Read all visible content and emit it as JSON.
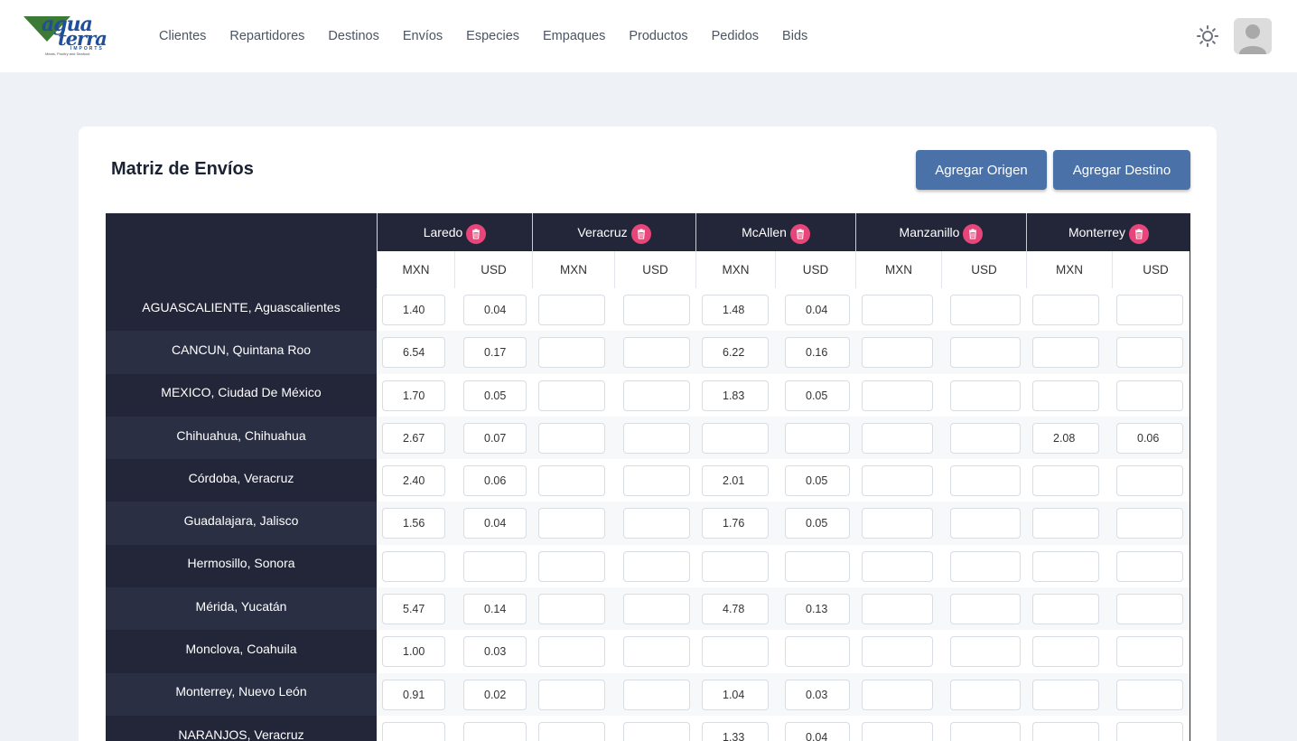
{
  "header": {
    "logo": {
      "line1": "agua",
      "line2": "terra",
      "line3": "IMPORTS",
      "tagline": "Meats, Poultry and Seafood"
    },
    "nav": [
      "Clientes",
      "Repartidores",
      "Destinos",
      "Envíos",
      "Especies",
      "Empaques",
      "Productos",
      "Pedidos",
      "Bids"
    ],
    "icons": {
      "theme": "sun-icon",
      "avatar": "user-avatar-icon"
    }
  },
  "page": {
    "title": "Matriz de Envíos",
    "buttons": {
      "agregar_origen": "Agregar Origen",
      "agregar_destino": "Agregar Destino"
    }
  },
  "matrix": {
    "colors": {
      "header_bg": "#222638",
      "trash": "#e8467a",
      "button": "#4a72a8"
    },
    "destinations": [
      "Laredo",
      "Veracruz",
      "McAllen",
      "Manzanillo",
      "Monterrey"
    ],
    "subheaders": [
      "MXN",
      "USD"
    ],
    "rows": [
      {
        "origin": "AGUASCALIENTE, Aguascalientes",
        "values": [
          [
            "1.40",
            "0.04"
          ],
          [
            "",
            ""
          ],
          [
            "1.48",
            "0.04"
          ],
          [
            "",
            ""
          ],
          [
            "",
            ""
          ]
        ]
      },
      {
        "origin": "CANCUN, Quintana Roo",
        "values": [
          [
            "6.54",
            "0.17"
          ],
          [
            "",
            ""
          ],
          [
            "6.22",
            "0.16"
          ],
          [
            "",
            ""
          ],
          [
            "",
            ""
          ]
        ]
      },
      {
        "origin": "MEXICO, Ciudad De México",
        "values": [
          [
            "1.70",
            "0.05"
          ],
          [
            "",
            ""
          ],
          [
            "1.83",
            "0.05"
          ],
          [
            "",
            ""
          ],
          [
            "",
            ""
          ]
        ]
      },
      {
        "origin": "Chihuahua, Chihuahua",
        "values": [
          [
            "2.67",
            "0.07"
          ],
          [
            "",
            ""
          ],
          [
            "",
            ""
          ],
          [
            "",
            ""
          ],
          [
            "2.08",
            "0.06"
          ]
        ]
      },
      {
        "origin": "Córdoba, Veracruz",
        "values": [
          [
            "2.40",
            "0.06"
          ],
          [
            "",
            ""
          ],
          [
            "2.01",
            "0.05"
          ],
          [
            "",
            ""
          ],
          [
            "",
            ""
          ]
        ]
      },
      {
        "origin": "Guadalajara, Jalisco",
        "values": [
          [
            "1.56",
            "0.04"
          ],
          [
            "",
            ""
          ],
          [
            "1.76",
            "0.05"
          ],
          [
            "",
            ""
          ],
          [
            "",
            ""
          ]
        ]
      },
      {
        "origin": "Hermosillo, Sonora",
        "values": [
          [
            "",
            ""
          ],
          [
            "",
            ""
          ],
          [
            "",
            ""
          ],
          [
            "",
            ""
          ],
          [
            "",
            ""
          ]
        ]
      },
      {
        "origin": "Mérida, Yucatán",
        "values": [
          [
            "5.47",
            "0.14"
          ],
          [
            "",
            ""
          ],
          [
            "4.78",
            "0.13"
          ],
          [
            "",
            ""
          ],
          [
            "",
            ""
          ]
        ]
      },
      {
        "origin": "Monclova, Coahuila",
        "values": [
          [
            "1.00",
            "0.03"
          ],
          [
            "",
            ""
          ],
          [
            "",
            ""
          ],
          [
            "",
            ""
          ],
          [
            "",
            ""
          ]
        ]
      },
      {
        "origin": "Monterrey, Nuevo León",
        "values": [
          [
            "0.91",
            "0.02"
          ],
          [
            "",
            ""
          ],
          [
            "1.04",
            "0.03"
          ],
          [
            "",
            ""
          ],
          [
            "",
            ""
          ]
        ]
      },
      {
        "origin": "NARANJOS, Veracruz",
        "values": [
          [
            "",
            ""
          ],
          [
            "",
            ""
          ],
          [
            "1.33",
            "0.04"
          ],
          [
            "",
            ""
          ],
          [
            "",
            ""
          ]
        ]
      }
    ]
  }
}
